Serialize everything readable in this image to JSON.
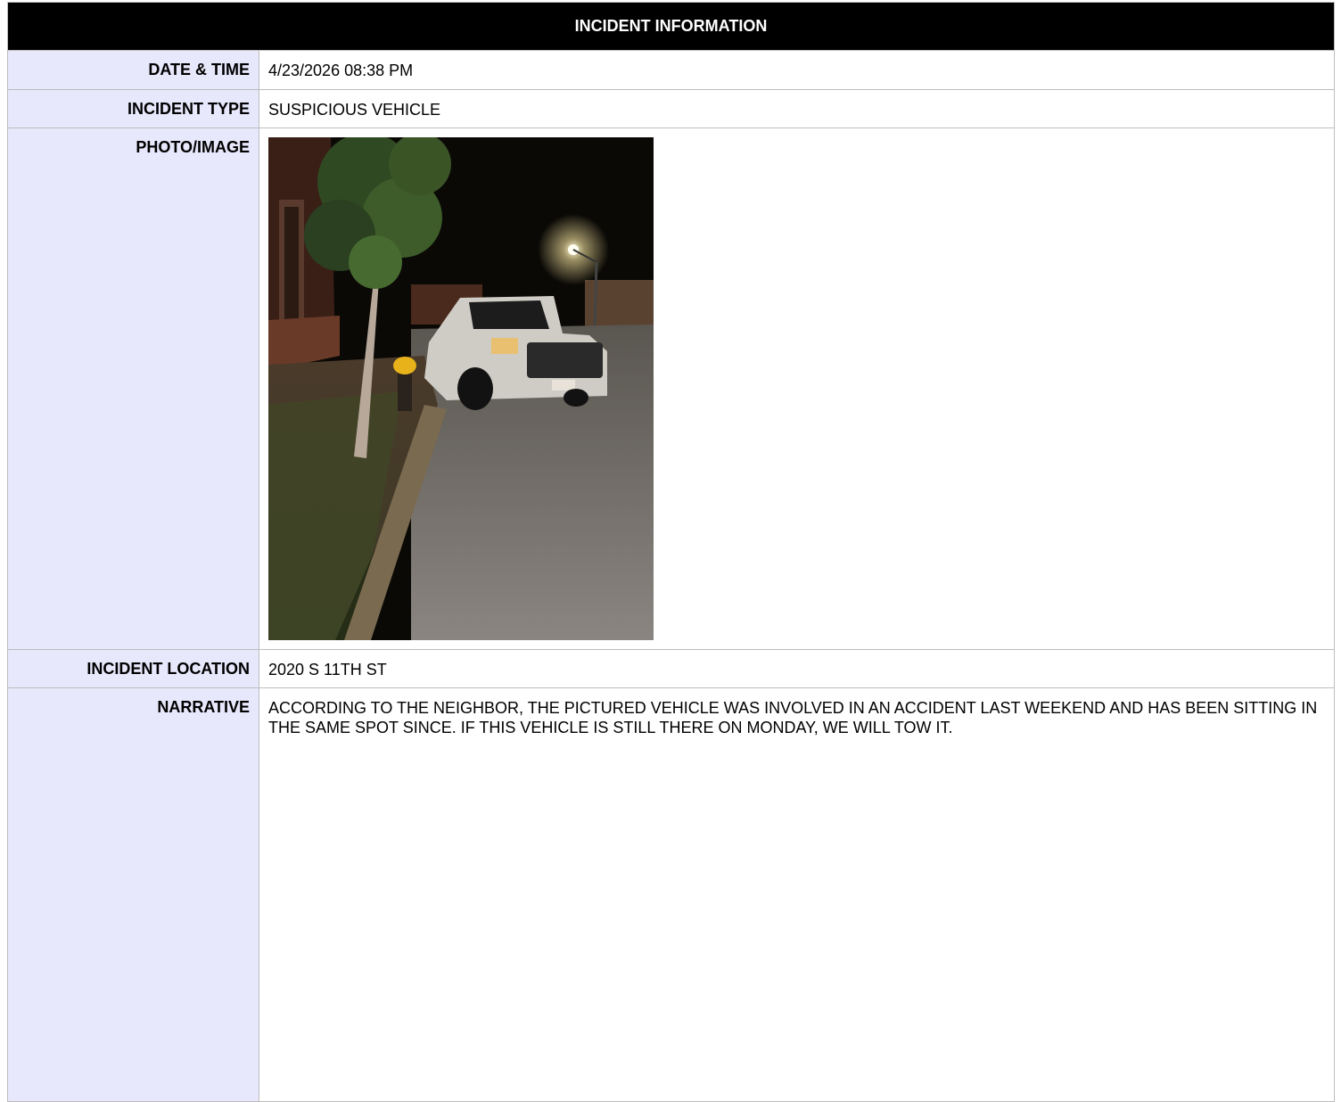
{
  "header": {
    "title": "INCIDENT INFORMATION"
  },
  "fields": {
    "date_time": {
      "label": "DATE & TIME",
      "value": "4/23/2026 08:38 PM"
    },
    "incident_type": {
      "label": "INCIDENT TYPE",
      "value": "SUSPICIOUS VEHICLE"
    },
    "photo": {
      "label": "PHOTO/IMAGE"
    },
    "location": {
      "label": "INCIDENT LOCATION",
      "value": "2020 S 11TH ST"
    },
    "narrative": {
      "label": "NARRATIVE",
      "value": "ACCORDING TO THE NEIGHBOR, THE PICTURED VEHICLE WAS INVOLVED IN AN ACCIDENT LAST WEEKEND AND HAS BEEN SITTING IN THE SAME SPOT SINCE. IF THIS VEHICLE IS STILL THERE ON MONDAY, WE WILL TOW IT."
    }
  },
  "colors": {
    "header_bg": "#000000",
    "header_text": "#ffffff",
    "label_bg": "#e8e8fc",
    "border": "#bdbdbd"
  }
}
